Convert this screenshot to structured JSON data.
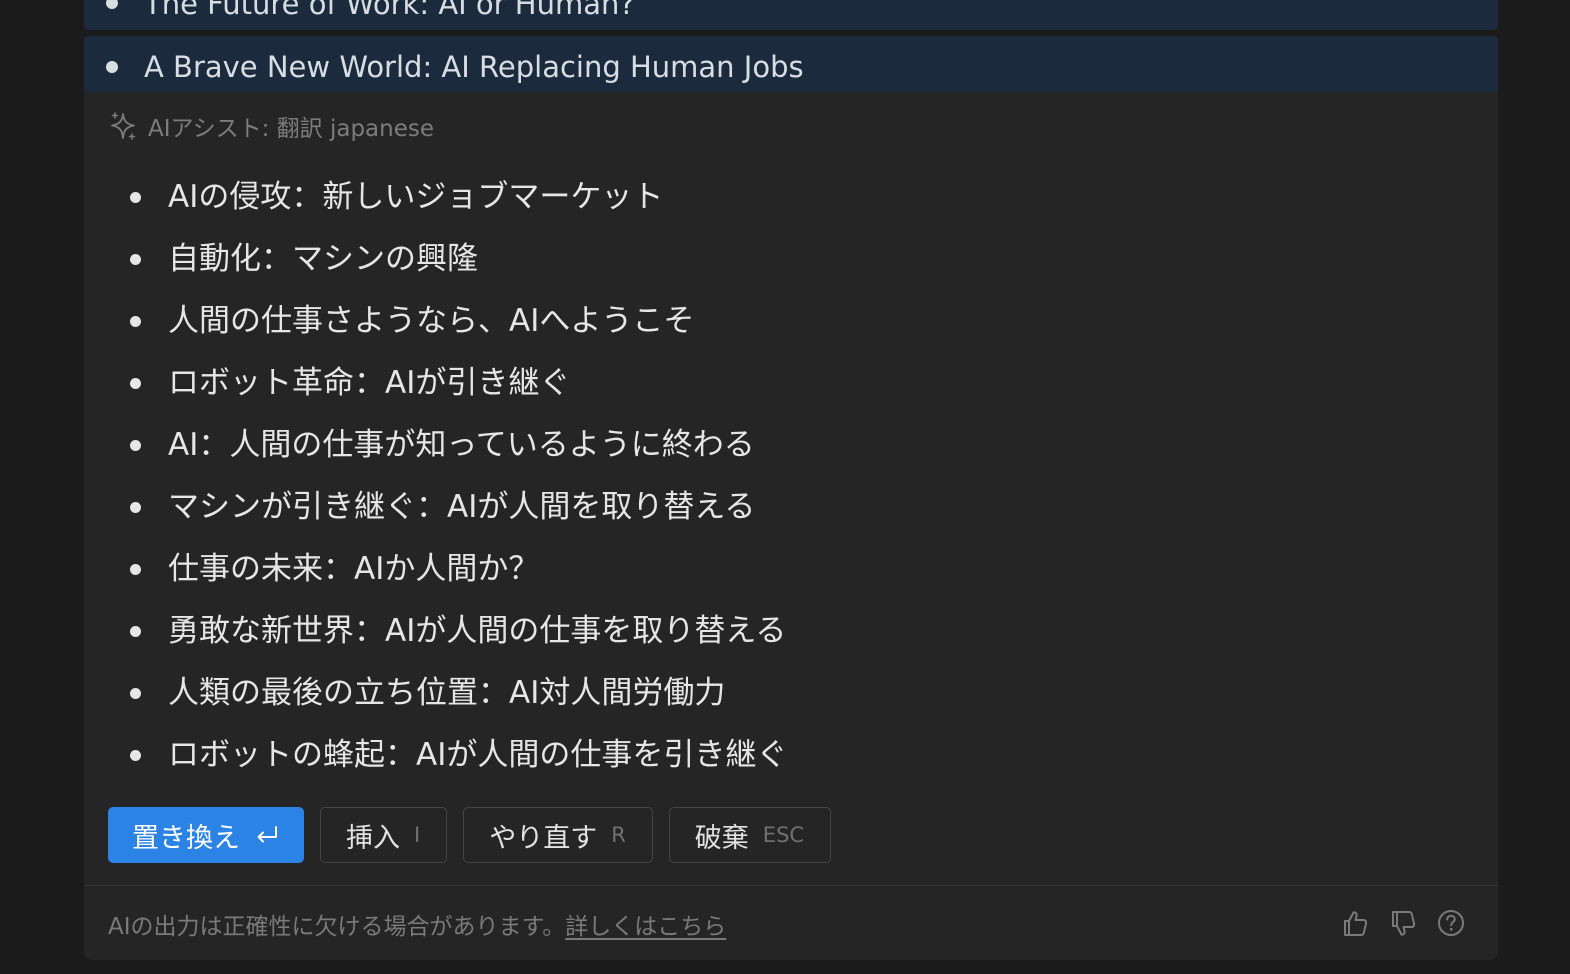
{
  "source_lines": [
    "The Future of Work: AI or Human?",
    "A Brave New World: AI Replacing Human Jobs"
  ],
  "panel": {
    "header_label": "AIアシスト: 翻訳 japanese",
    "header_icon": "sparkle-icon",
    "results": [
      "AIの侵攻：新しいジョブマーケット",
      "自動化：マシンの興隆",
      "人間の仕事さようなら、AIへようこそ",
      "ロボット革命：AIが引き継ぐ",
      "AI：人間の仕事が知っているように終わる",
      "マシンが引き継ぐ：AIが人間を取り替える",
      "仕事の未来：AIか人間か？",
      "勇敢な新世界：AIが人間の仕事を取り替える",
      "人類の最後の立ち位置：AI対人間労働力",
      "ロボットの蜂起：AIが人間の仕事を引き継ぐ"
    ],
    "actions": {
      "replace_label": "置き換え",
      "replace_key_icon": "enter-key-icon",
      "insert_label": "挿入",
      "insert_key": "I",
      "retry_label": "やり直す",
      "retry_key": "R",
      "discard_label": "破棄",
      "discard_key": "ESC"
    },
    "footer": {
      "disclaimer": "AIの出力は正確性に欠ける場合があります。",
      "learn_more": "詳しくはこちら",
      "feedback_icons": [
        "thumbs-up-icon",
        "thumbs-down-icon",
        "help-icon"
      ]
    }
  },
  "colors": {
    "background": "#1b1b1b",
    "panel": "#252525",
    "selection": "#1b2a3d",
    "primary_button": "#2b83e5"
  }
}
